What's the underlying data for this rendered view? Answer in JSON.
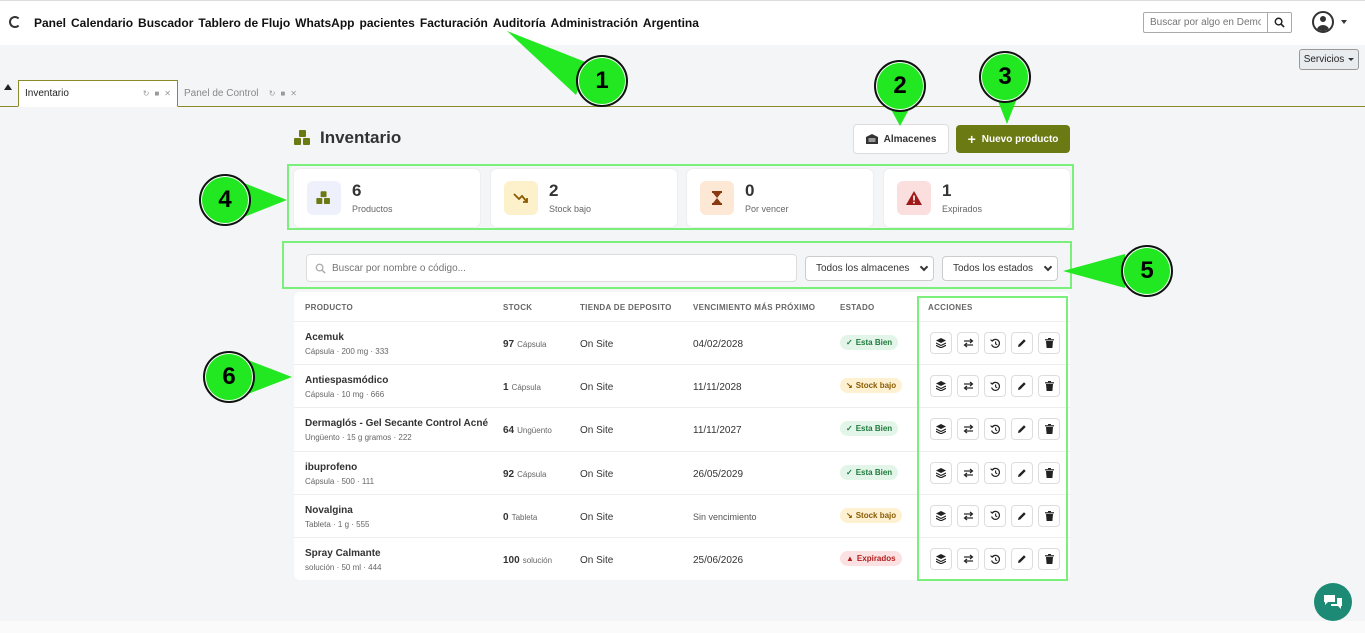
{
  "nav": {
    "items": [
      "Panel",
      "Calendario",
      "Buscador",
      "Tablero de Flujo",
      "WhatsApp",
      "pacientes",
      "Facturación",
      "Auditoría",
      "Administración",
      "Argentina"
    ],
    "search_placeholder": "Buscar por algo en Demografía",
    "services_label": "Servicios"
  },
  "tabs": [
    {
      "label": "Inventario",
      "active": true
    },
    {
      "label": "Panel de Control",
      "active": false
    }
  ],
  "page": {
    "title": "Inventario",
    "almacenes_label": "Almacenes",
    "nuevo_label": "Nuevo producto"
  },
  "stats": [
    {
      "value": "6",
      "label": "Productos",
      "icon": "boxes-icon"
    },
    {
      "value": "2",
      "label": "Stock bajo",
      "icon": "trend-down-icon"
    },
    {
      "value": "0",
      "label": "Por vencer",
      "icon": "hourglass-icon"
    },
    {
      "value": "1",
      "label": "Expirados",
      "icon": "warning-icon"
    }
  ],
  "filters": {
    "search_placeholder": "Buscar por nombre o código...",
    "warehouse_select": "Todos los almacenes",
    "status_select": "Todos los estados"
  },
  "table": {
    "headers": {
      "product": "PRODUCTO",
      "stock": "STOCK",
      "store": "TIENDA DE DEPOSITO",
      "expiry": "VENCIMIENTO MÁS PRÓXIMO",
      "status": "ESTADO",
      "actions": "ACCIONES"
    },
    "rows": [
      {
        "name": "Acemuk",
        "sub": "Cápsula · 200 mg · 333",
        "stock": "97",
        "unit": "Cápsula",
        "store": "On Site",
        "expiry": "04/02/2028",
        "status": "Esta Bien",
        "status_kind": "ok"
      },
      {
        "name": "Antiespasmódico",
        "sub": "Cápsula · 10 mg · 666",
        "stock": "1",
        "unit": "Cápsula",
        "store": "On Site",
        "expiry": "11/11/2028",
        "status": "Stock bajo",
        "status_kind": "low"
      },
      {
        "name": "Dermaglós - Gel Secante Control Acné",
        "sub": "Ungüento · 15 g gramos · 222",
        "stock": "64",
        "unit": "Ungüento",
        "store": "On Site",
        "expiry": "11/11/2027",
        "status": "Esta Bien",
        "status_kind": "ok"
      },
      {
        "name": "ibuprofeno",
        "sub": "Cápsula · 500 · 111",
        "stock": "92",
        "unit": "Cápsula",
        "store": "On Site",
        "expiry": "26/05/2029",
        "status": "Esta Bien",
        "status_kind": "ok"
      },
      {
        "name": "Novalgina",
        "sub": "Tableta · 1 g · 555",
        "stock": "0",
        "unit": "Tableta",
        "store": "On Site",
        "expiry": "Sin vencimiento",
        "status": "Stock bajo",
        "status_kind": "low"
      },
      {
        "name": "Spray Calmante",
        "sub": "solución · 50 ml · 444",
        "stock": "100",
        "unit": "solución",
        "store": "On Site",
        "expiry": "25/06/2026",
        "status": "Expirados",
        "status_kind": "exp"
      }
    ]
  },
  "annotations": [
    "1",
    "2",
    "3",
    "4",
    "5",
    "6"
  ],
  "colors": {
    "accent": "#6b7a12",
    "annotation": "#22e822"
  }
}
